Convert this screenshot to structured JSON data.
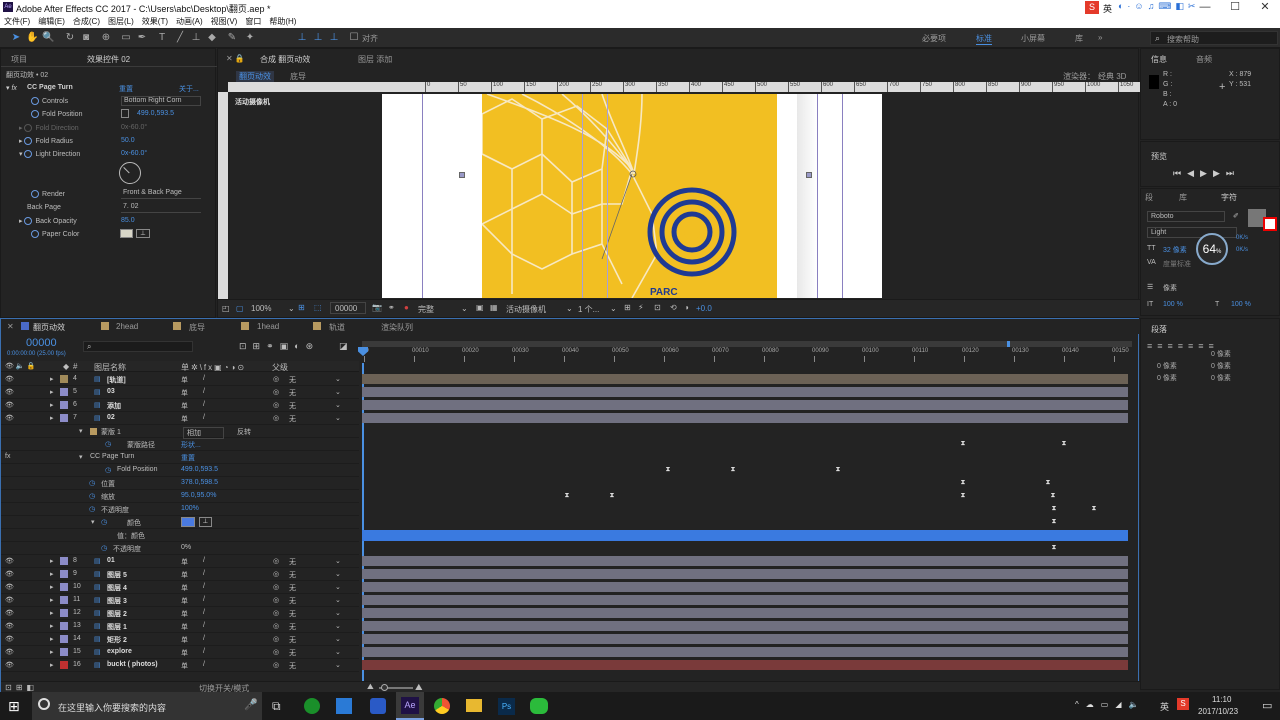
{
  "window": {
    "title": "Adobe After Effects CC 2017 - C:\\Users\\abc\\Desktop\\翻页.aep *",
    "min": "—",
    "max": "☐",
    "close": "✕"
  },
  "menu": [
    "文件(F)",
    "编辑(E)",
    "合成(C)",
    "图层(L)",
    "效果(T)",
    "动画(A)",
    "视图(V)",
    "窗口",
    "帮助(H)"
  ],
  "toolbar": {
    "align": "对齐",
    "workspaces": [
      "必要项",
      "标准",
      "小屏幕",
      "库"
    ],
    "search_placeholder": "搜索帮助",
    "ime": "英"
  },
  "left_panel": {
    "tab_project": "项目",
    "tab_effects": "效果控件 02",
    "layer_name": "翻页动效 • 02",
    "effect": "CC Page Turn",
    "reset": "重置",
    "about": "关于...",
    "props": [
      {
        "label": "Controls",
        "value": "Bottom Right Corn"
      },
      {
        "label": "Fold Position",
        "value": "499.0,593.5"
      },
      {
        "label": "Fold Direction",
        "value": "0x-60.0°"
      },
      {
        "label": "Fold Radius",
        "value": "50.0"
      },
      {
        "label": "Light Direction",
        "value": "0x-60.0°"
      },
      {
        "label": "Render",
        "value": "Front & Back Page"
      },
      {
        "label": "Back Page",
        "value": "7. 02"
      },
      {
        "label": "Back Opacity",
        "value": "85.0"
      },
      {
        "label": "Paper Color",
        "value": ""
      }
    ]
  },
  "comp": {
    "tab": "合成 翻页动效",
    "tab2": "图层 添加",
    "sub1": "翻页动效",
    "sub2": "底导",
    "renderer": "渲染器：",
    "renderer_value": "经典 3D",
    "camera_label": "活动摄像机",
    "ruler": [
      "0",
      "50",
      "100",
      "150",
      "200",
      "250",
      "300",
      "350",
      "400",
      "450",
      "500",
      "550",
      "600",
      "650",
      "700",
      "750",
      "800",
      "850",
      "900",
      "950",
      "1000",
      "1050",
      "1100"
    ],
    "zoom": "100%",
    "time": "00000",
    "quality": "完整",
    "camera": "活动摄像机",
    "views": "1 个...",
    "offset": "+0.0",
    "brand": "PARC"
  },
  "info": {
    "tab1": "信息",
    "tab2": "音频",
    "r": "R :",
    "g": "G :",
    "b": "B :",
    "a": "A : 0",
    "x": "X : 879",
    "y": "Y : 531"
  },
  "preview": {
    "tab": "预览"
  },
  "char": {
    "tab1": "段",
    "tab2": "库",
    "tab3": "字符",
    "font": "Roboto",
    "style": "Light",
    "size": "32 像素",
    "leading_label": "度量标准",
    "tracking": "0",
    "kern": "像素",
    "pct1": "100 %",
    "pct2": "100 %",
    "badge": "64",
    "badge_unit": "%",
    "speed1": "0K/s",
    "speed2": "0K/s"
  },
  "para": {
    "tab": "段落",
    "v": [
      "0 像素",
      "0 像素",
      "0 像素",
      "0 像素",
      "0 像素"
    ]
  },
  "timeline": {
    "tabs": [
      "翻页动效",
      "2head",
      "底导",
      "1head",
      "轨道",
      "渲染队列"
    ],
    "timecode": "00000",
    "fps": "0:00:00:00 (25.00 fps)",
    "col_name": "图层名称",
    "col_parent": "父级",
    "switch": "切换开关/模式",
    "ticks": [
      "00",
      "00010",
      "00020",
      "00030",
      "00040",
      "00050",
      "00060",
      "00070",
      "00080",
      "00090",
      "00100",
      "00110",
      "00120",
      "00130",
      "00140",
      "00150"
    ],
    "layers": [
      {
        "n": "4",
        "name": "[轨道]",
        "col": "#a08a5a",
        "parent": "无"
      },
      {
        "n": "5",
        "name": "03",
        "col": "#8c8cc8",
        "parent": "无"
      },
      {
        "n": "6",
        "name": "添加",
        "col": "#8c8cc8",
        "parent": "无"
      },
      {
        "n": "7",
        "name": "02",
        "col": "#8c8cc8",
        "parent": "无"
      }
    ],
    "mask": {
      "label": "蒙版 1",
      "mode": "相加",
      "invert": "反转",
      "path": "蒙版路径",
      "path_val": "形状..."
    },
    "effect": {
      "label": "CC Page Turn",
      "reset": "重置",
      "fold": "Fold Position",
      "fold_val": "499.0,593.5"
    },
    "transform": [
      {
        "label": "位置",
        "val": "378.0,598.5"
      },
      {
        "label": "缩放",
        "val": "95.0,95.0%"
      },
      {
        "label": "不透明度",
        "val": "100%"
      }
    ],
    "color": {
      "label": "颜色",
      "val_label": "值：颜色",
      "opacity": "不透明度",
      "opacity_val": "0%"
    },
    "layers2": [
      {
        "n": "8",
        "name": "01",
        "col": "#8c8cc8",
        "parent": "无"
      },
      {
        "n": "9",
        "name": "图层 5",
        "col": "#8c8cc8",
        "parent": "无"
      },
      {
        "n": "10",
        "name": "图层 4",
        "col": "#8c8cc8",
        "parent": "无"
      },
      {
        "n": "11",
        "name": "图层 3",
        "col": "#8c8cc8",
        "parent": "无"
      },
      {
        "n": "12",
        "name": "图层 2",
        "col": "#8c8cc8",
        "parent": "无"
      },
      {
        "n": "13",
        "name": "图层 1",
        "col": "#8c8cc8",
        "parent": "无"
      },
      {
        "n": "14",
        "name": "矩形 2",
        "col": "#8c8cc8",
        "parent": "无"
      },
      {
        "n": "15",
        "name": "explore",
        "col": "#8c8cc8",
        "parent": "无"
      },
      {
        "n": "16",
        "name": "buckt ( photos)",
        "col": "#c03030",
        "parent": "无"
      }
    ]
  },
  "taskbar": {
    "search": "在这里输入你要搜索的内容",
    "time": "11:10",
    "date": "2017/10/23",
    "ime": "英"
  },
  "colors": {
    "accent": "#4a90e2",
    "yellow": "#f2bf22",
    "bar": "#707080",
    "red_bar": "#7a3a3a"
  }
}
